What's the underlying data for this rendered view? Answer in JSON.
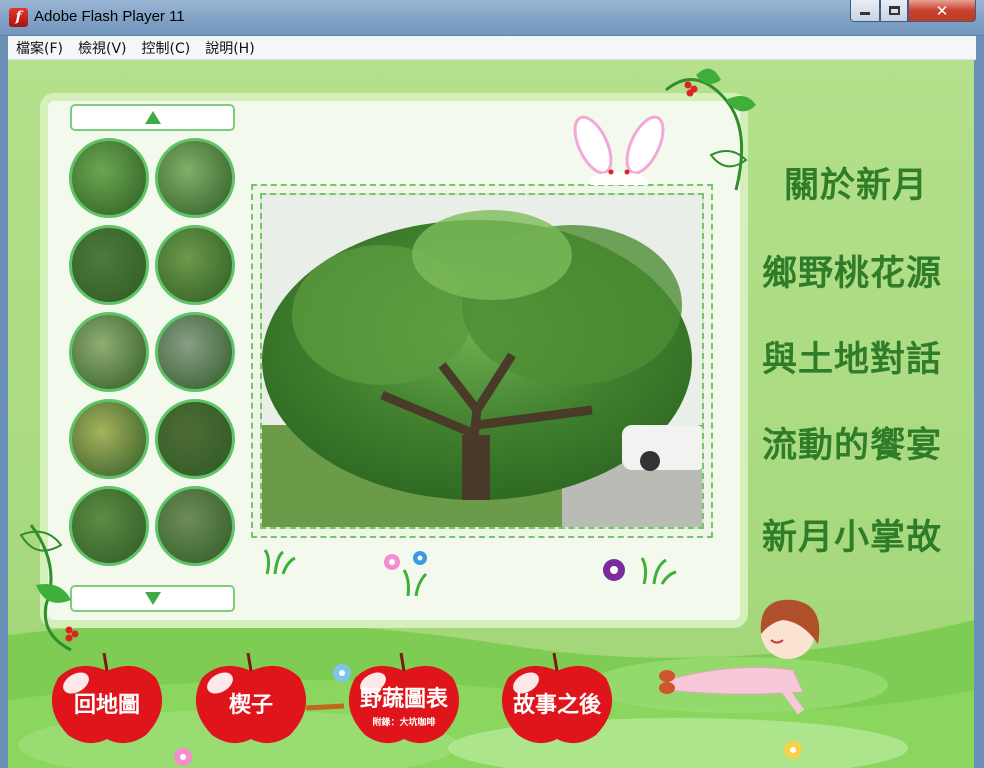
{
  "window": {
    "title": "Adobe Flash Player 11",
    "icon": "flash-player-icon",
    "icon_glyph": "f",
    "close_glyph": "✕"
  },
  "menu": {
    "items": [
      {
        "label": "檔案(F)"
      },
      {
        "label": "檢視(V)"
      },
      {
        "label": "控制(C)"
      },
      {
        "label": "說明(H)"
      }
    ]
  },
  "gallery": {
    "scroll_up": "up-arrow-icon",
    "scroll_down": "down-arrow-icon",
    "thumbnails": [
      {
        "name": "thumb-green-fruit",
        "color": "#6aa84f"
      },
      {
        "name": "thumb-fruit-on-branch",
        "color": "#7fb069"
      },
      {
        "name": "thumb-fruit-dark",
        "color": "#4e7a3c"
      },
      {
        "name": "thumb-leaves",
        "color": "#6c9a4a"
      },
      {
        "name": "thumb-twigs",
        "color": "#8fae73"
      },
      {
        "name": "thumb-undergrowth",
        "color": "#889d86"
      },
      {
        "name": "thumb-flower-buds",
        "color": "#a6b35e"
      },
      {
        "name": "thumb-trunk",
        "color": "#4d6c35"
      },
      {
        "name": "thumb-leaf-closeup",
        "color": "#5c8c44"
      },
      {
        "name": "thumb-pink-blossom",
        "color": "#6d8d58"
      }
    ]
  },
  "main_photo": {
    "subject": "large leafy tree photo"
  },
  "nav": {
    "items": [
      {
        "label": "關於新月"
      },
      {
        "label": "鄉野桃花源"
      },
      {
        "label": "與土地對話"
      },
      {
        "label": "流動的饗宴"
      },
      {
        "label": "新月小掌故"
      }
    ]
  },
  "apples": {
    "items": [
      {
        "label": "回地圖",
        "sub": ""
      },
      {
        "label": "楔子",
        "sub": ""
      },
      {
        "label": "野蔬圖表",
        "sub": "附錄：大坑咖啡"
      },
      {
        "label": "故事之後",
        "sub": ""
      }
    ]
  },
  "colors": {
    "accent_green": "#2f7d29",
    "apple_red": "#e0141b",
    "stage_green": "#b5e08d"
  }
}
